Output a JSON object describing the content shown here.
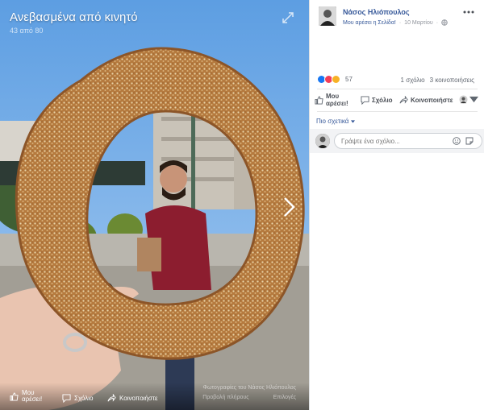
{
  "album": {
    "title": "Ανεβασμένα από κινητό",
    "counter": "43 από 80"
  },
  "photo_bar": {
    "like_label": "Μου\nαρέσει!",
    "comment_label": "Σχόλιο",
    "share_label": "Κοινοποιήστε",
    "credit": "Φωτογραφίες του Νάσος Ηλιόπουλος",
    "link_1": "Προβολή πλήρους",
    "link_2": "Επιλογές"
  },
  "post": {
    "author": "Νάσος Ηλιόπουλος",
    "like_page": "Μου αρέσει η Σελίδα!",
    "separator": "·",
    "date": "10 Μαρτίου",
    "reaction_count": "57",
    "comments_count": "1 σχόλιο",
    "shares_count": "3 κοινοποιήσεις"
  },
  "actions": {
    "like_line1": "Μου",
    "like_line2": "αρέσει!",
    "comment": "Σχόλιο",
    "share": "Κοινοποιήστε"
  },
  "comments": {
    "filter_label": "Πιο σχετικά",
    "input_placeholder": "Γράψτε ένα σχόλιο..."
  },
  "icons": {
    "expand": "expand-icon",
    "next": "chevron-right-icon",
    "more": "ellipsis-icon",
    "globe": "globe-icon",
    "like": "thumbs-up-icon",
    "comment": "speech-bubble-icon",
    "share": "share-arrow-icon",
    "emoji": "emoji-icon",
    "sticker": "sticker-icon"
  },
  "colors": {
    "link": "#365899",
    "like_reaction": "#1877f2",
    "love_reaction": "#f33e58",
    "haha_reaction": "#f7b125",
    "comment_bg": "#f2f3f5"
  }
}
